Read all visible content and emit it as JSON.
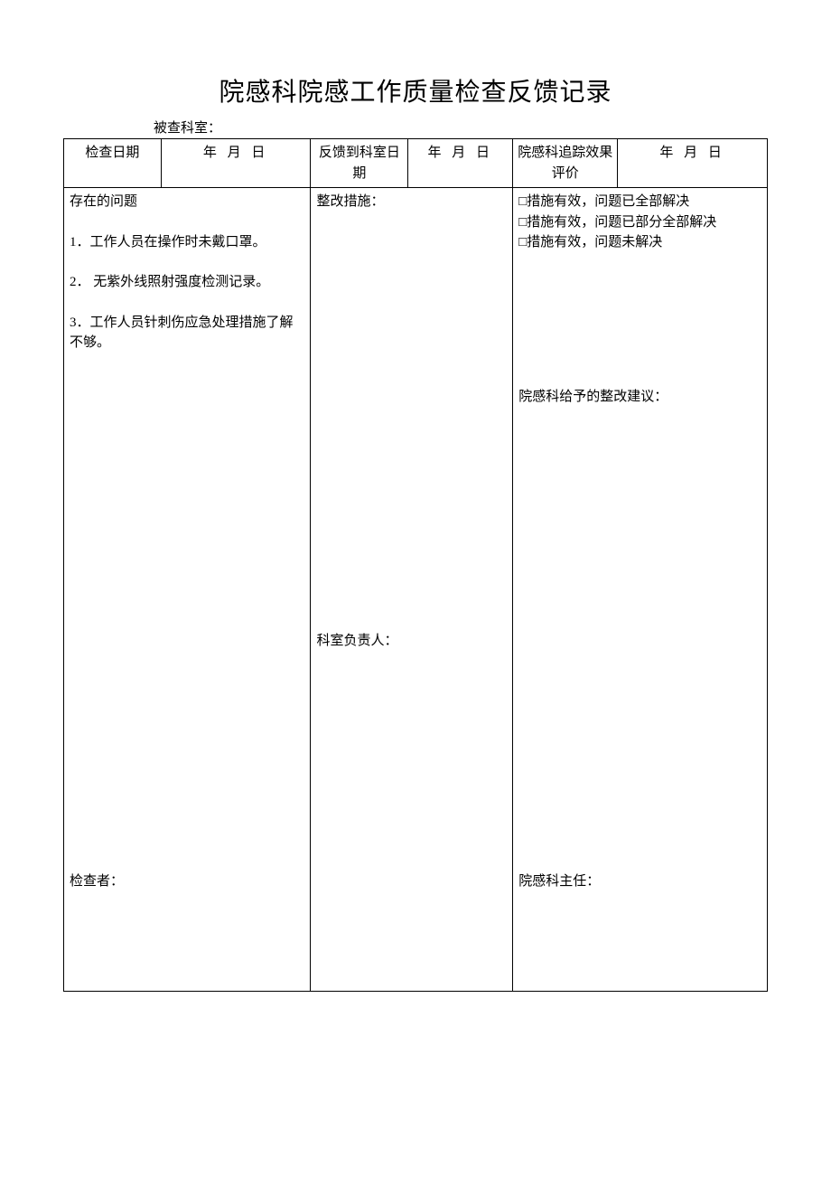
{
  "title": "院感科院感工作质量检查反馈记录",
  "subhead_label": "被查科室：",
  "header": {
    "check_date_label": "检查日期",
    "check_date_value": "年    月    日",
    "feedback_date_label": "反馈到科室日期",
    "feedback_date_value": "年 月    日",
    "track_label": "院感科追踪效果评价",
    "track_value": "年    月    日"
  },
  "issues": {
    "heading": "存在的问题",
    "p1": "1．工作人员在操作时未戴口罩。",
    "p2": "2．  无紫外线照射强度检测记录。",
    "p3": "3．工作人员针刺伤应急处理措施了解不够。"
  },
  "corrective_label": "整改措施：",
  "dept_head_label": "科室负责人：",
  "inspector_label": "检查者：",
  "options": {
    "o1": "措施有效，问题已全部解决",
    "o2": "措施有效，问题已部分全部解决",
    "o3": "措施有效，问题未解决"
  },
  "suggestion_label": "院感科给予的整改建议：",
  "director_label": "院感科主任："
}
